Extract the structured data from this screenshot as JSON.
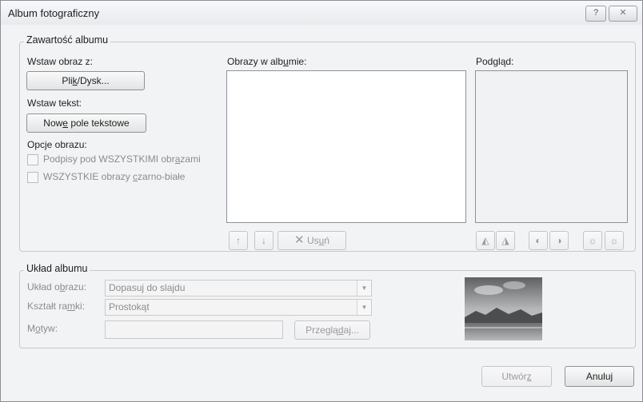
{
  "window": {
    "title": "Album fotograficzny",
    "help_glyph": "?",
    "close_glyph": "✕"
  },
  "content": {
    "legend": "Zawartość albumu",
    "insert_picture_label": "Wstaw obraz z:",
    "file_disk": {
      "pre": "Pli",
      "u": "k",
      "post": "/Dysk..."
    },
    "insert_text_label": "Wstaw tekst:",
    "new_textbox": {
      "pre": "Now",
      "u": "e",
      "post": " pole tekstowe"
    },
    "picture_options_label": "Opcje obrazu:",
    "captions": {
      "pre": "Podpisy pod WSZYSTKIMI obr",
      "u": "a",
      "post": "zami",
      "checked": false
    },
    "black_white": {
      "pre": "WSZYSTKIE obrazy ",
      "u": "c",
      "post": "zarno-białe",
      "checked": false
    },
    "pictures_label": {
      "pre": "Obrazy w alb",
      "u": "u",
      "post": "mie:"
    },
    "preview_label": "Podgląd:",
    "remove": {
      "pre": "Us",
      "u": "u",
      "post": "ń"
    }
  },
  "layout": {
    "legend": "Układ albumu",
    "picture_layout_label": {
      "pre": "Układ o",
      "u": "b",
      "post": "razu:"
    },
    "picture_layout_value": "Dopasuj do slajdu",
    "frame_shape_label": {
      "pre": "Kształt ra",
      "u": "m",
      "post": "ki:"
    },
    "frame_shape_value": "Prostokąt",
    "theme_label": {
      "pre": "M",
      "u": "o",
      "post": "tyw:"
    },
    "theme_value": "",
    "browse": {
      "pre": "Przeglą",
      "u": "d",
      "post": "aj..."
    }
  },
  "footer": {
    "create": {
      "pre": "Utwór",
      "u": "z",
      "post": ""
    },
    "cancel": "Anuluj"
  },
  "colors": {
    "accent_disabled": "#9a9a9a",
    "border": "#8e9297"
  }
}
